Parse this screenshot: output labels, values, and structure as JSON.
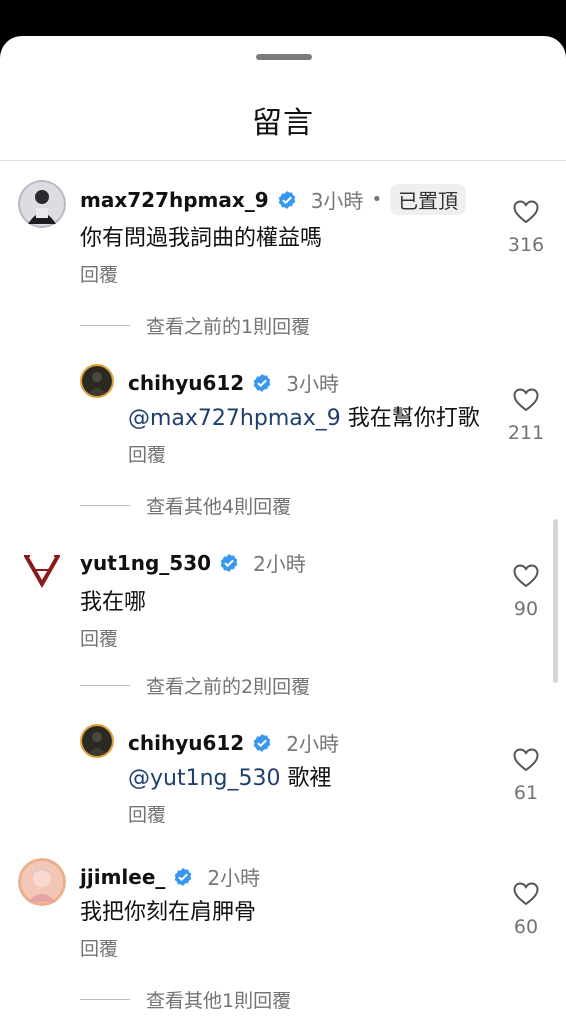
{
  "sheet": {
    "title": "留言"
  },
  "comments": [
    {
      "username": "max727hpmax_9",
      "time": "3小時",
      "dot": "•",
      "pinned_label": "已置頂",
      "text": "你有問過我詞曲的權益嗎",
      "reply_label": "回覆",
      "likes": "316",
      "thread_label": "查看之前的1則回覆",
      "reply": {
        "username": "chihyu612",
        "time": "3小時",
        "mention": "@max727hpmax_9",
        "text": " 我在幫你打歌",
        "reply_label": "回覆",
        "likes": "211"
      },
      "more_label": "查看其他4則回覆"
    },
    {
      "username": "yut1ng_530",
      "time": "2小時",
      "text": "我在哪",
      "reply_label": "回覆",
      "likes": "90",
      "thread_label": "查看之前的2則回覆",
      "reply": {
        "username": "chihyu612",
        "time": "2小時",
        "mention": "@yut1ng_530",
        "text": " 歌裡",
        "reply_label": "回覆",
        "likes": "61"
      }
    },
    {
      "username": "jjimlee_",
      "time": "2小時",
      "text": "我把你刻在肩胛骨",
      "reply_label": "回覆",
      "likes": "60",
      "more_label": "查看其他1則回覆"
    }
  ],
  "colors": {
    "verified": "#3897f0",
    "mention": "#1e3f6e",
    "secondary_text": "#737373",
    "vlogo": "#8b1a1a"
  },
  "icons": {
    "like": "heart-outline-icon",
    "verified": "verified-badge-icon"
  }
}
